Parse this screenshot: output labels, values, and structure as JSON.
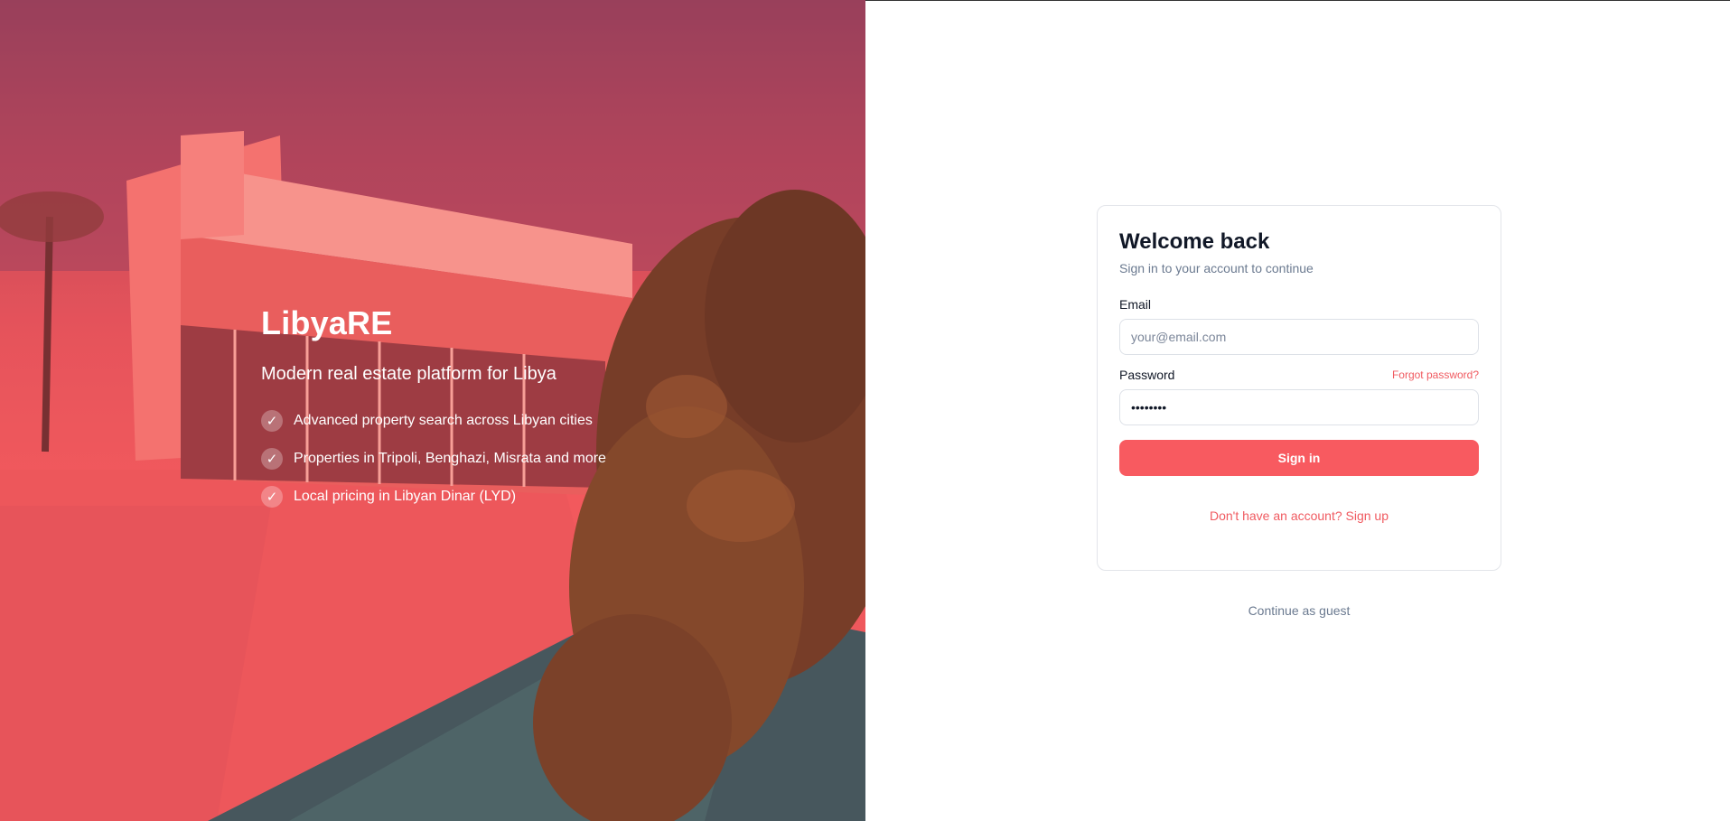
{
  "hero": {
    "brand": "LibyaRE",
    "tagline": "Modern real estate platform for Libya",
    "check_glyph": "✓",
    "features": [
      "Advanced property search across Libyan cities",
      "Properties in Tripoli, Benghazi, Misrata and more",
      "Local pricing in Libyan Dinar (LYD)"
    ],
    "overlay_color": "#ef5c5e"
  },
  "login": {
    "title": "Welcome back",
    "subtitle": "Sign in to your account to continue",
    "email_label": "Email",
    "email_placeholder": "your@email.com",
    "email_value": "",
    "password_label": "Password",
    "forgot_label": "Forgot password?",
    "password_value": "password",
    "signin_label": "Sign in",
    "signup_label": "Don't have an account? Sign up"
  },
  "guest_label": "Continue as guest",
  "colors": {
    "accent": "#f85a60",
    "muted_text": "#6b7a90",
    "heading": "#111827"
  }
}
